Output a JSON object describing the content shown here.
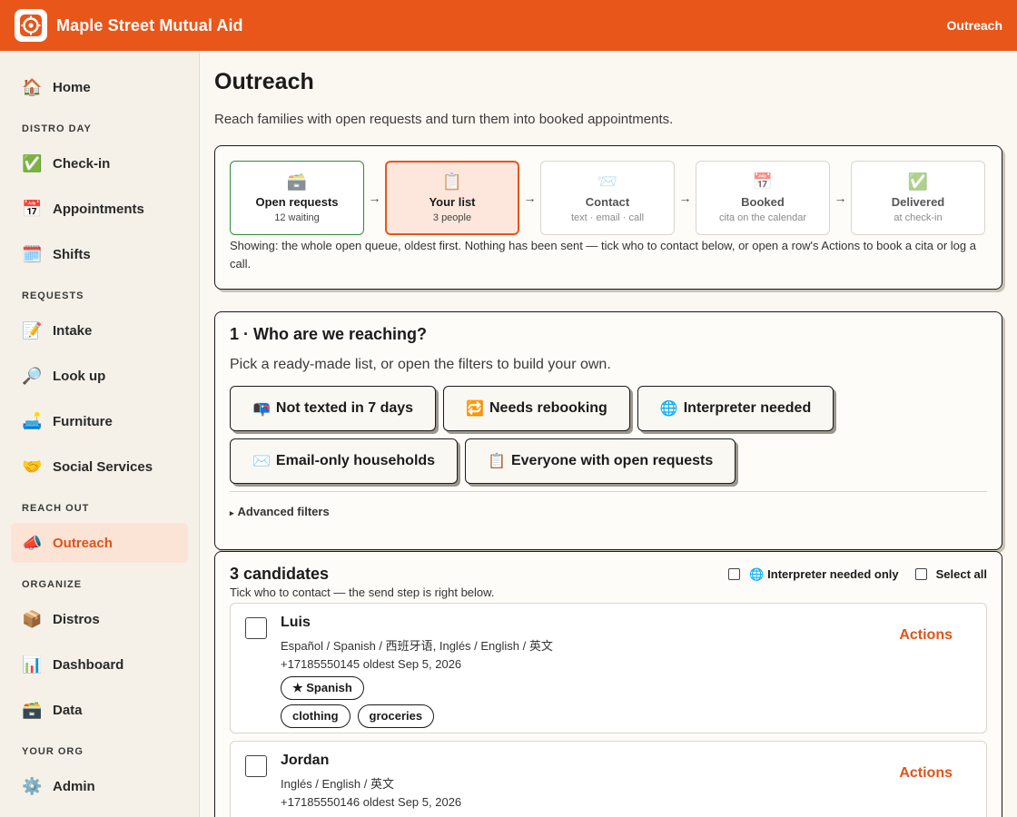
{
  "header": {
    "app_name": "Maple Street Mutual Aid",
    "right_link": "Outreach"
  },
  "sidebar": {
    "home": {
      "label": "Home",
      "icon": "house-icon"
    },
    "sections": [
      {
        "title": "DISTRO DAY",
        "items": [
          {
            "label": "Check-in",
            "icon": "check-mark-icon",
            "glyph": "✅"
          },
          {
            "label": "Appointments",
            "icon": "calendar-icon",
            "glyph": "📅"
          },
          {
            "label": "Shifts",
            "icon": "spiral-calendar-icon",
            "glyph": "🗓️"
          }
        ]
      },
      {
        "title": "REQUESTS",
        "items": [
          {
            "label": "Intake",
            "icon": "memo-icon",
            "glyph": "📝"
          },
          {
            "label": "Look up",
            "icon": "magnifier-icon",
            "glyph": "🔎"
          },
          {
            "label": "Furniture",
            "icon": "couch-icon",
            "glyph": "🛋️"
          },
          {
            "label": "Social Services",
            "icon": "handshake-icon",
            "glyph": "🤝"
          }
        ]
      },
      {
        "title": "REACH OUT",
        "items": [
          {
            "label": "Outreach",
            "icon": "megaphone-icon",
            "glyph": "📣",
            "active": true
          }
        ]
      },
      {
        "title": "ORGANIZE",
        "items": [
          {
            "label": "Distros",
            "icon": "package-icon",
            "glyph": "📦"
          },
          {
            "label": "Dashboard",
            "icon": "bar-chart-icon",
            "glyph": "📊"
          },
          {
            "label": "Data",
            "icon": "card-file-box-icon",
            "glyph": "🗃️"
          }
        ]
      },
      {
        "title": "YOUR ORG",
        "items": [
          {
            "label": "Admin",
            "icon": "gear-icon",
            "glyph": "⚙️"
          }
        ]
      }
    ]
  },
  "page": {
    "title": "Outreach",
    "subtitle": "Reach families with open requests and turn them into booked appointments."
  },
  "pipeline": {
    "steps": [
      {
        "title": "Open requests",
        "sub": "12 waiting",
        "icon": "card-file-box-icon",
        "glyph": "🗃️",
        "state": "done"
      },
      {
        "title": "Your list",
        "sub": "3 people",
        "icon": "clipboard-icon",
        "glyph": "📋",
        "state": "current"
      },
      {
        "title": "Contact",
        "sub": "text · email · call",
        "icon": "envelope-icon",
        "glyph": "📨",
        "state": "pending"
      },
      {
        "title": "Booked",
        "sub": "cita on the calendar",
        "icon": "calendar-icon",
        "glyph": "📅",
        "state": "pending"
      },
      {
        "title": "Delivered",
        "sub": "at check-in",
        "icon": "check-mark-icon",
        "glyph": "✅",
        "state": "pending"
      }
    ],
    "note": "Showing: the whole open queue, oldest first. Nothing has been sent — tick who to contact below, or open a row's Actions to book a cita or log a call."
  },
  "reach": {
    "title": "1 · Who are we reaching?",
    "subtitle": "Pick a ready-made list, or open the filters to build your own.",
    "presets": [
      {
        "label": "Not texted in 7 days",
        "icon": "mailbox-icon",
        "glyph": "📭"
      },
      {
        "label": "Needs rebooking",
        "icon": "repeat-icon",
        "glyph": "🔁"
      },
      {
        "label": "Interpreter needed",
        "icon": "globe-icon",
        "glyph": "🌐"
      },
      {
        "label": "Email-only households",
        "icon": "envelope-icon",
        "glyph": "✉️"
      },
      {
        "label": "Everyone with open requests",
        "icon": "clipboard-icon",
        "glyph": "📋"
      }
    ],
    "advanced": "Advanced filters"
  },
  "candidates": {
    "title": "3 candidates",
    "subtitle": "Tick who to contact — the send step is right below.",
    "filter_interpreter": "Interpreter needed only",
    "select_all": "Select all",
    "actions_label": "Actions",
    "rows": [
      {
        "name": "Luis",
        "languages": "Español / Spanish / 西班牙语, Inglés / English / 英文",
        "meta": "+17185550145   oldest Sep 5, 2026",
        "tags": [
          "★ Spanish",
          "clothing",
          "groceries"
        ]
      },
      {
        "name": "Jordan",
        "languages": "Inglés / English / 英文",
        "meta": "+17185550146   oldest Sep 5, 2026",
        "tags": []
      }
    ]
  },
  "colors": {
    "brand": "#e8561a",
    "done": "#2e8b3a",
    "active_bg": "#fde7dc"
  }
}
